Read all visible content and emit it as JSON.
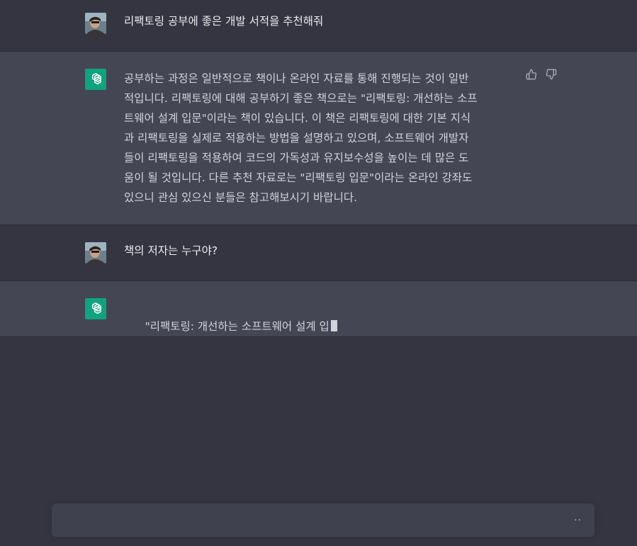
{
  "conversation": {
    "messages": [
      {
        "role": "user",
        "avatar_icon": "user-photo-avatar",
        "text": "리팩토링 공부에 좋은 개발 서적을 추천해줘"
      },
      {
        "role": "assistant",
        "avatar_icon": "openai-logo-icon",
        "text": "공부하는 과정은 일반적으로 책이나 온라인 자료를 통해 진행되는 것이 일반\n적입니다. 리팩토링에 대해 공부하기 좋은 책으로는 \"리팩토링: 개선하는 소프\n트웨어 설계 입문\"이라는 책이 있습니다. 이 책은 리팩토링에 대한 기본 지식\n과 리팩토링을 실제로 적용하는 방법을 설명하고 있으며, 소프트웨어 개발자\n들이 리팩토링을 적용하여 코드의 가독성과 유지보수성을 높이는 데 많은 도\n움이 될 것입니다. 다른 추천 자료로는 \"리팩토링 입문\"이라는 온라인 강좌도\n있으니 관심 있으신 분들은 참고해보시기 바랍니다.",
        "feedback": {
          "thumbs_up_icon": "thumbs-up-icon",
          "thumbs_down_icon": "thumbs-down-icon"
        }
      },
      {
        "role": "user",
        "avatar_icon": "user-photo-avatar",
        "text": "책의 저자는 누구야?"
      },
      {
        "role": "assistant",
        "avatar_icon": "openai-logo-icon",
        "text": "\"리팩토링: 개선하는 소프트웨어 설계 입",
        "streaming": true
      }
    ]
  },
  "composer": {
    "placeholder": "",
    "value": "",
    "status_indicator": "··"
  },
  "colors": {
    "page_background": "#343541",
    "assistant_background": "#444654",
    "composer_background": "#40414f",
    "bot_avatar": "#10a37f",
    "text": "#d1d5db"
  }
}
